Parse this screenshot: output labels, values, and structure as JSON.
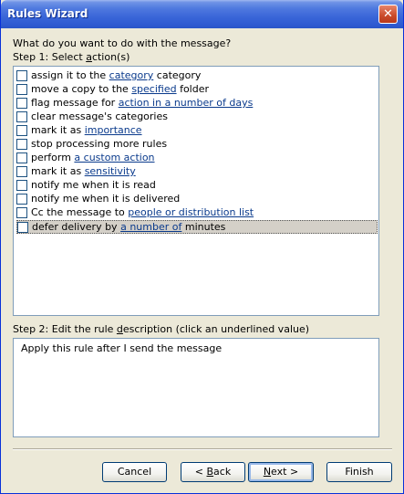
{
  "window": {
    "title": "Rules Wizard",
    "close_glyph": "✕"
  },
  "question": "What do you want to do with the message?",
  "step1": {
    "pre": "Step 1: Select ",
    "u": "a",
    "post": "ction(s)"
  },
  "actions": [
    {
      "pre": "assign it to the ",
      "link": "category",
      "post": " category",
      "checked": false
    },
    {
      "pre": "move a copy to the ",
      "link": "specified",
      "post": " folder",
      "checked": false
    },
    {
      "pre": "flag message for ",
      "link": "action in a number of days",
      "post": "",
      "checked": false
    },
    {
      "pre": "clear message's categories",
      "link": "",
      "post": "",
      "checked": false
    },
    {
      "pre": "mark it as ",
      "link": "importance",
      "post": "",
      "checked": false
    },
    {
      "pre": "stop processing more rules",
      "link": "",
      "post": "",
      "checked": false
    },
    {
      "pre": "perform ",
      "link": "a custom action",
      "post": "",
      "checked": false
    },
    {
      "pre": "mark it as ",
      "link": "sensitivity",
      "post": "",
      "checked": false
    },
    {
      "pre": "notify me when it is read",
      "link": "",
      "post": "",
      "checked": false
    },
    {
      "pre": "notify me when it is delivered",
      "link": "",
      "post": "",
      "checked": false
    },
    {
      "pre": "Cc the message to ",
      "link": "people or distribution list",
      "post": "",
      "checked": false
    },
    {
      "pre": "defer delivery by ",
      "link": "a number of",
      "post": " minutes",
      "checked": false,
      "selected": true
    }
  ],
  "step2": {
    "pre": "Step 2: Edit the rule ",
    "u": "d",
    "post": "escription (click an underlined value)"
  },
  "description": "Apply this rule after I send the message",
  "buttons": {
    "cancel": "Cancel",
    "back": {
      "pre": "< ",
      "u": "B",
      "post": "ack"
    },
    "next": {
      "u": "N",
      "post": "ext >"
    },
    "finish": "Finish"
  }
}
